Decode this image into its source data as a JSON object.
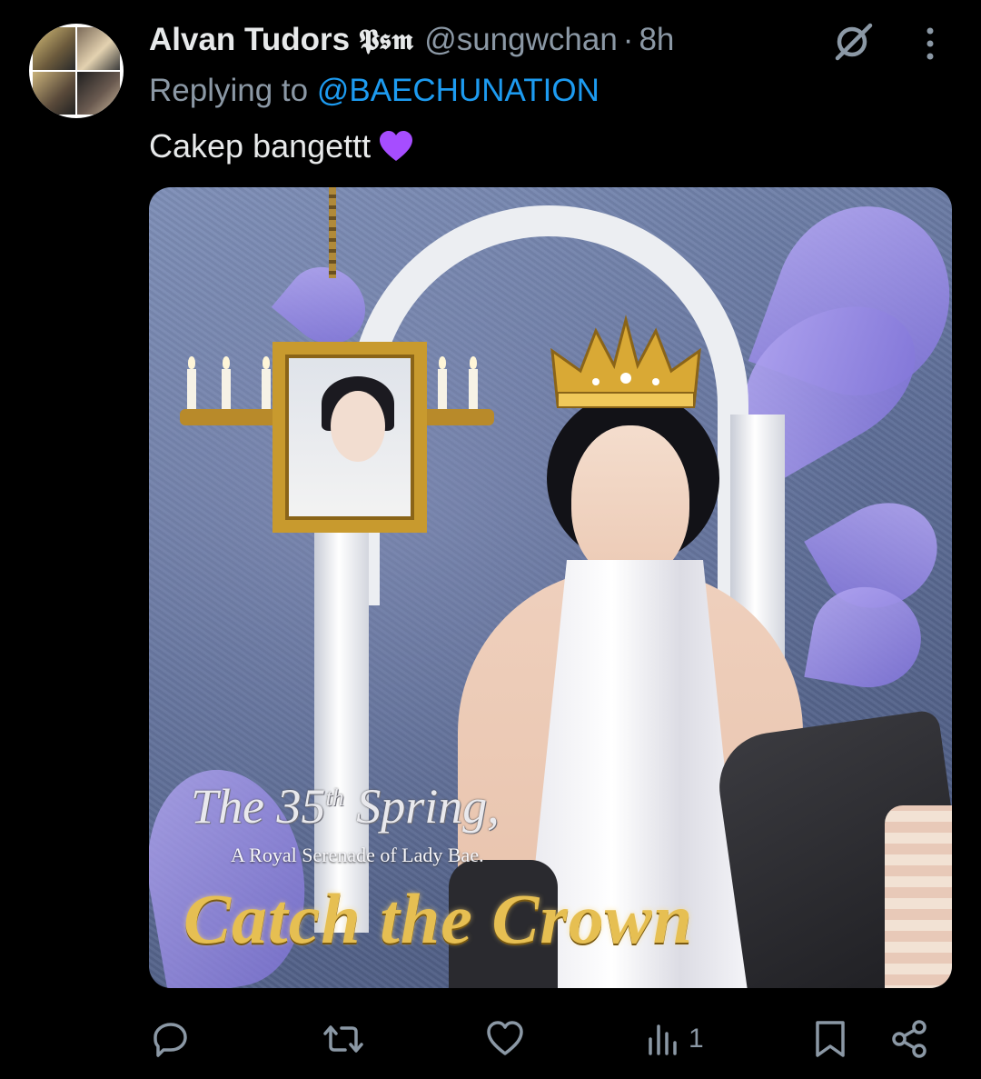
{
  "post": {
    "display_name": "Alvan Tudors",
    "name_badge": "𝕻𝖘𝖒",
    "handle": "@sungwchan",
    "separator": "·",
    "time": "8h",
    "reply_prefix": "Replying to ",
    "reply_to": "@BAECHUNATION",
    "text": "Cakep bangettt",
    "emoji": "purple-heart"
  },
  "media": {
    "title_line1": "The 35",
    "title_line1_sup": "th",
    "title_line1_end": " Spring,",
    "subtitle": "A Royal Serenade of Lady Bae.",
    "headline": "Catch the Crown"
  },
  "actions": {
    "reply_icon": "reply-icon",
    "repost_icon": "repost-icon",
    "like_icon": "like-icon",
    "views_icon": "views-icon",
    "views_count": "1",
    "bookmark_icon": "bookmark-icon",
    "share_icon": "share-icon"
  },
  "colors": {
    "background": "#000000",
    "text": "#e7e9ea",
    "muted": "#8b98a5",
    "link": "#1d9bf0",
    "heart": "#a64dff"
  }
}
